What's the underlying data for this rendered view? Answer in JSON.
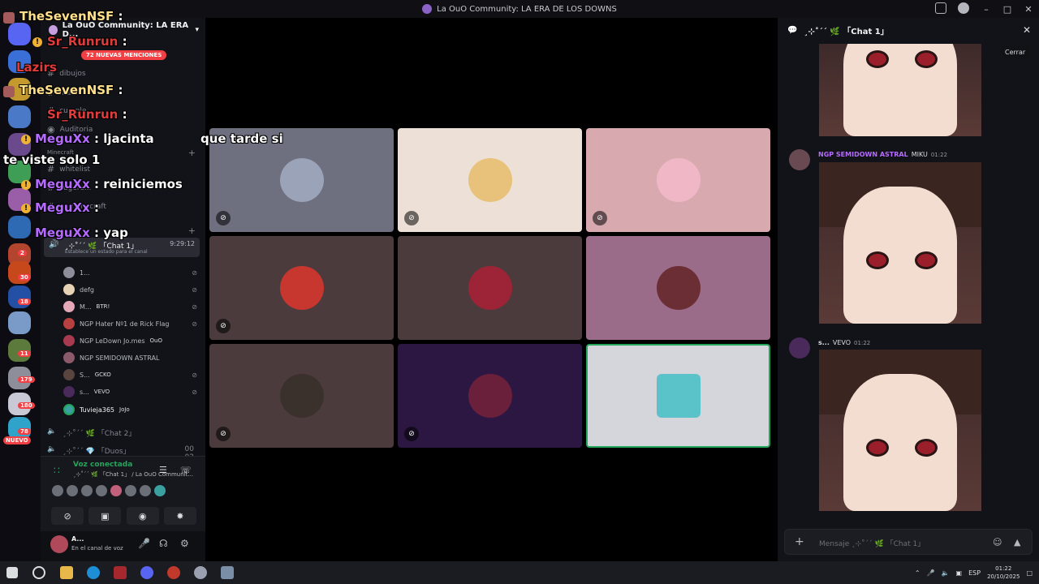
{
  "window": {
    "title": "La OuO Community: LA ERA DE LOS DOWNS"
  },
  "server": {
    "name": "La OuO Community: LA ERA D...",
    "mentions_badge": "72 NUEVAS MENCIONES",
    "channels": [
      "dibujos",
      "man...",
      "cumple...",
      "Auditoria",
      "whitelist",
      "sugere...",
      "en-minecraft"
    ],
    "category_minecraft": "Minecraft"
  },
  "rail": {
    "badges": [
      "2",
      "30",
      "18",
      "11",
      "179",
      "180",
      "78"
    ],
    "new_label": "NUEVO"
  },
  "voice_channel": {
    "name": "¸⊹˚´´ 🌿 「Chat 1」",
    "timer": "9:29:12",
    "status_hint": "Establece un estado para el canal",
    "members": [
      {
        "name": "1...",
        "tag": ""
      },
      {
        "name": "defg",
        "tag": ""
      },
      {
        "name": "M...",
        "tag": "BTR!"
      },
      {
        "name": "NGP Hater Nº1 de Rick Flag",
        "tag": ""
      },
      {
        "name": "NGP LeDown Jo.mes",
        "tag": "OuO"
      },
      {
        "name": "NGP SEMIDOWN ASTRAL",
        "tag": ""
      },
      {
        "name": "S...",
        "tag": "GCKO"
      },
      {
        "name": "s...",
        "tag": "VEVO"
      },
      {
        "name": "Tuvieja365",
        "tag": "JoJo"
      }
    ],
    "other_channels": [
      "¸⊹˚´´ 🌿 「Chat 2」",
      "¸⊹˚´´ 💎 「Duos」"
    ],
    "other_channel_count": "00 02"
  },
  "voice_panel": {
    "title": "Voz conectada",
    "subtitle": "¸⊹˚´´ 🌿 「Chat 1」 / La OuO Communit..."
  },
  "user": {
    "name": "A...",
    "status": "En el canal de voz"
  },
  "overlay": [
    {
      "user": "TheSevenNSF",
      "text": ":",
      "color": "#ffe08a"
    },
    {
      "user": "Sr_Runrun",
      "text": ":",
      "color": "#e23b3b"
    },
    {
      "user": "Lazirs",
      "text": "",
      "color": "#e23b3b"
    },
    {
      "user": "TheSevenNSF",
      "text": ":",
      "color": "#ffe08a"
    },
    {
      "user": "Sr_Runrun",
      "text": ":",
      "color": "#e23b3b"
    },
    {
      "user": "MeguXx",
      "text": ": ljacinta",
      "color": "#b56bff"
    },
    {
      "user": "",
      "text": "que tarde si",
      "color": "#ffffff"
    },
    {
      "user": "",
      "text": "te viste solo 1",
      "color": "#ffffff"
    },
    {
      "user": "MeguXx",
      "text": ": reiniciemos",
      "color": "#b56bff"
    },
    {
      "user": "MeguXx",
      "text": ":",
      "color": "#b56bff"
    },
    {
      "user": "MeguXx",
      "text": ": yap",
      "color": "#b56bff"
    }
  ],
  "chat": {
    "header": "¸⊹˚´´ 🌿 「Chat 1」",
    "close_tooltip": "Cerrar",
    "messages": [
      {
        "user": "NGP SEMIDOWN ASTRAL",
        "role": "MIKU",
        "time": "01:22",
        "color": "#b56bff"
      },
      {
        "user": "s...",
        "role": "VEVO",
        "time": "01:22",
        "color": "#dbdee1"
      }
    ],
    "composer_placeholder": "Mensaje ¸⊹˚´´ 🌿 「Chat 1」"
  },
  "taskbar": {
    "lang": "ESP",
    "time": "01:22",
    "date": "20/10/2025"
  },
  "colors": {
    "accent": "#23a55a",
    "danger": "#f23f43",
    "bg": "#121318"
  }
}
